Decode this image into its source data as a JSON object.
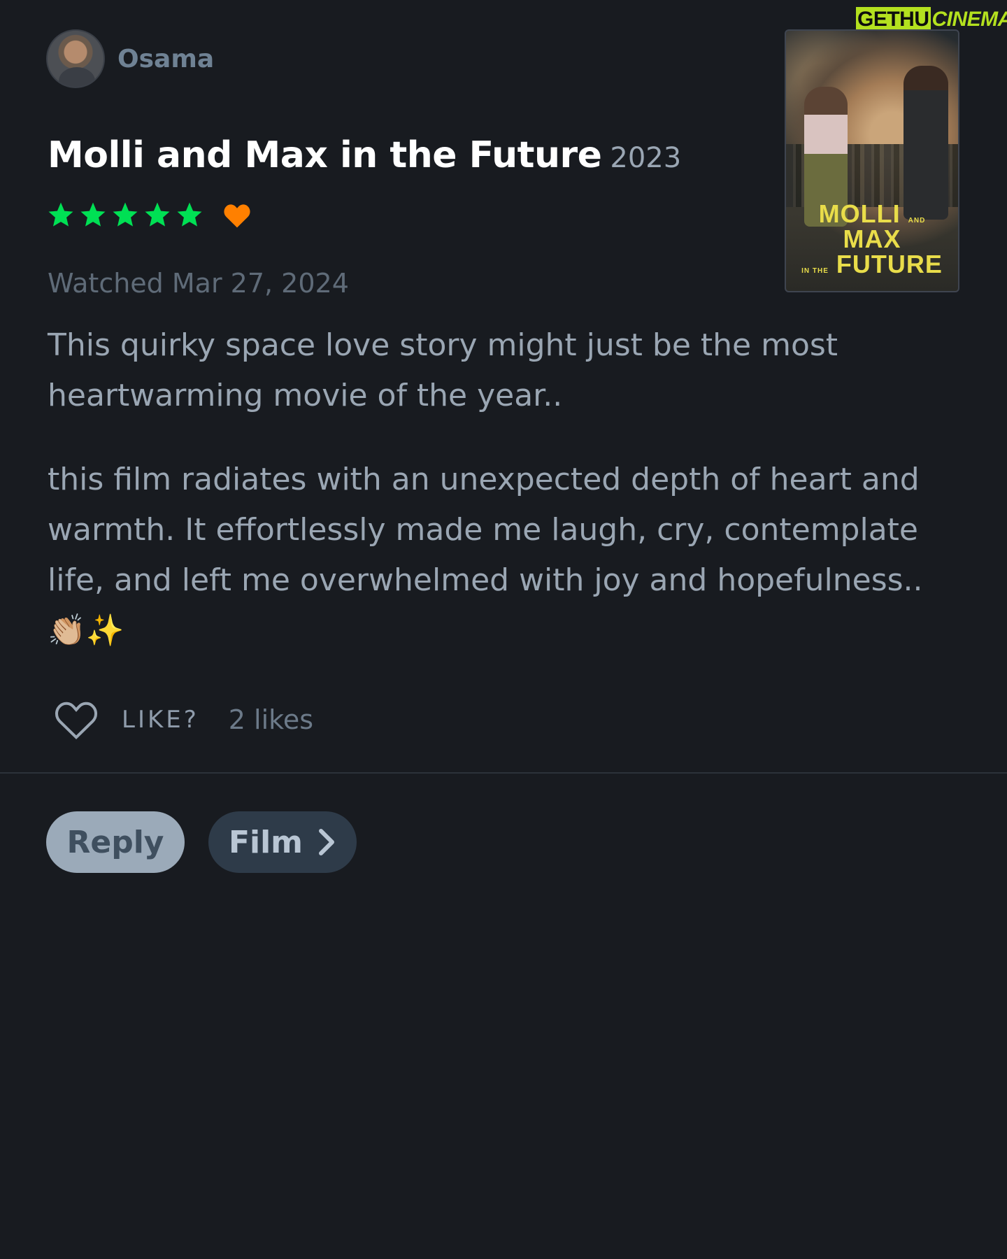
{
  "watermark": {
    "part1": "GETHU",
    "part2": "CINEMA"
  },
  "user": {
    "name": "Osama"
  },
  "film": {
    "title": "Molli and Max in the Future",
    "year": "2023",
    "poster": {
      "line1": "MOLLI",
      "and": "AND",
      "line1b": "MAX",
      "in_the": "IN THE",
      "line2": "FUTURE"
    }
  },
  "rating": {
    "stars": 5,
    "max_stars": 5,
    "liked": true,
    "star_color": "#00e054",
    "heart_color": "#ff8000"
  },
  "watched": "Watched Mar 27, 2024",
  "review": {
    "paragraphs": [
      "This quirky space love story might just be the most heartwarming movie of the year..",
      "this film radiates with an unexpected depth of heart and warmth. It effortlessly made me laugh, cry, contemplate life, and left me overwhelmed with joy and hopefulness.. 👏🏼✨"
    ]
  },
  "like": {
    "label": "LIKE?",
    "count": "2 likes"
  },
  "buttons": {
    "reply": "Reply",
    "film": "Film"
  }
}
